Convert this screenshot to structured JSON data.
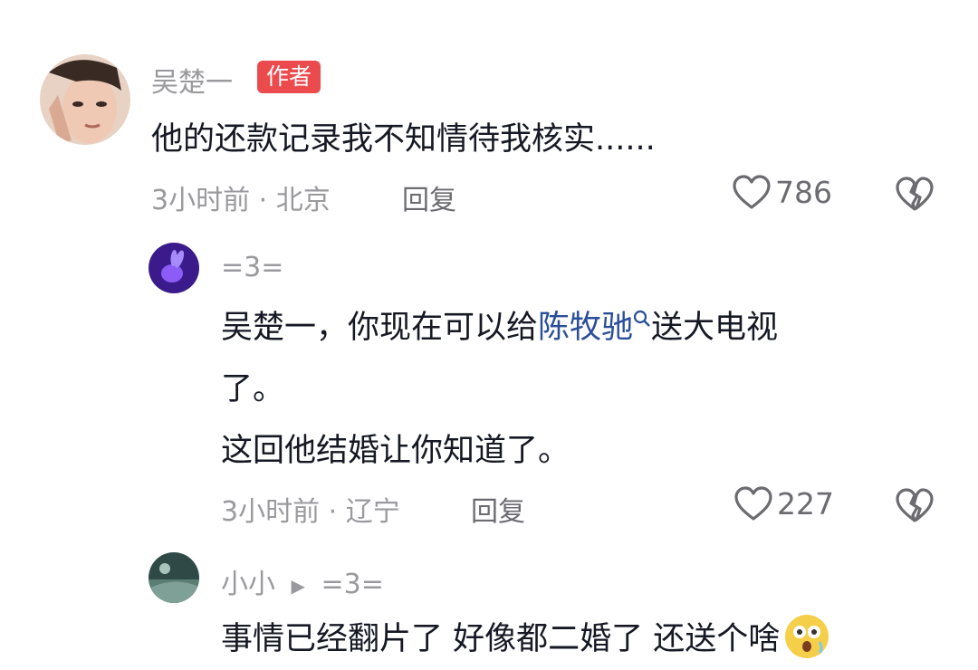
{
  "comments": [
    {
      "author": "吴楚一",
      "badge": "作者",
      "text": "他的还款记录我不知情待我核实......",
      "meta": "3小时前 · 北京",
      "reply_label": "回复",
      "likes": "786"
    },
    {
      "author": "=3=",
      "text_line1_pre": "吴楚一，你现在可以给",
      "mention": "陈牧驰",
      "text_line1_post": "送大电视",
      "text_line2": "了。",
      "text_line3": "这回他结婚让你知道了。",
      "meta": "3小时前 · 辽宁",
      "reply_label": "回复",
      "likes": "227"
    },
    {
      "author": "小小",
      "reply_arrow": "▶",
      "reply_to": "=3=",
      "text": "事情已经翻片了  好像都二婚了  还送个啥"
    }
  ],
  "icons": {
    "like": "heart-outline-icon",
    "dislike": "broken-heart-icon",
    "search_hint": "search-icon",
    "emoji": "surprised-emoji-icon"
  },
  "colors": {
    "badge": "#ec4b4e",
    "mention": "#2b4e9a",
    "meta": "#9a9a9e"
  }
}
